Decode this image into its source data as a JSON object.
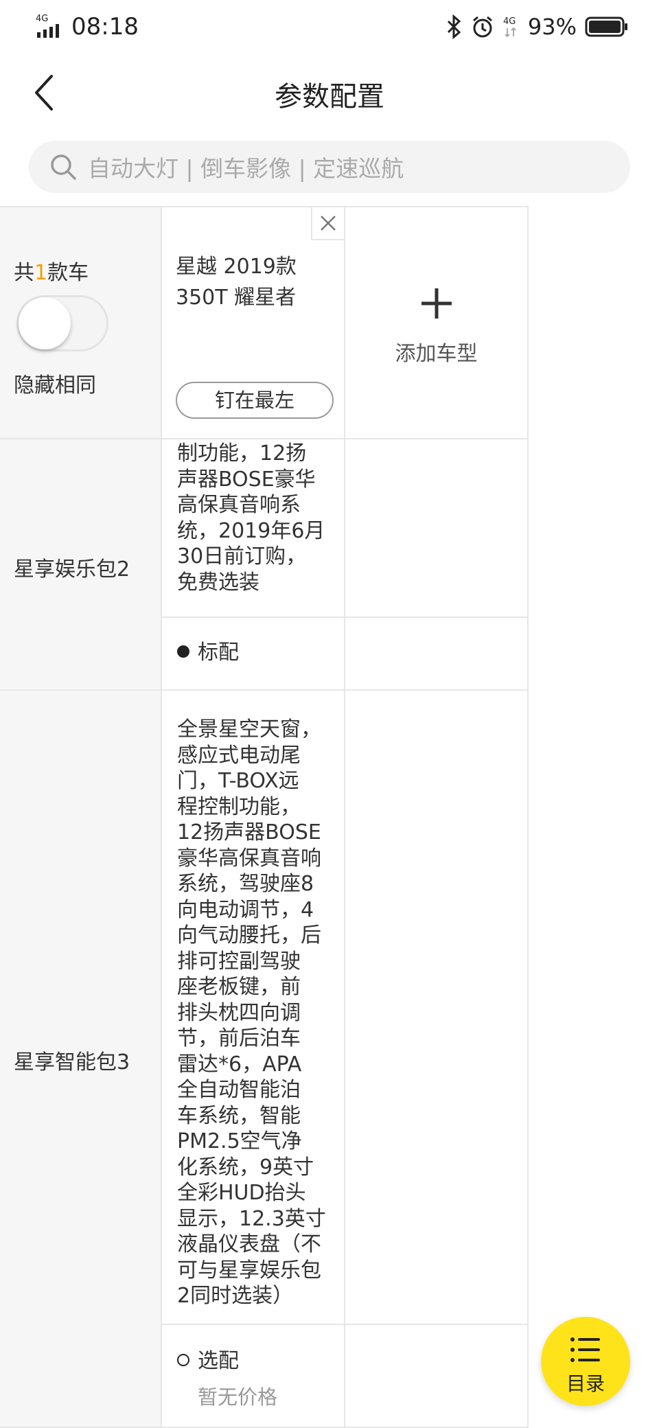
{
  "status_bar": {
    "network": "4G",
    "time": "08:18",
    "network_right": "4G",
    "battery": "93%",
    "icons": [
      "signal-icon",
      "bluetooth-icon",
      "alarm-icon",
      "battery-icon"
    ]
  },
  "nav": {
    "title": "参数配置",
    "back_icon": "chevron-left-icon"
  },
  "search": {
    "placeholder": "自动大灯 | 倒车影像 | 定速巡航",
    "icon": "search-icon"
  },
  "header": {
    "count_prefix": "共",
    "count": "1",
    "count_suffix": "款车",
    "hide_same_label": "隐藏相同",
    "hide_same_on": false,
    "car": {
      "name_line1": "星越 2019款",
      "name_line2": "350T 耀星者",
      "pin_label": "钉在最左"
    },
    "add_label": "添加车型"
  },
  "rows": [
    {
      "label": "星享娱乐包2",
      "description_lines": [
        "制功能，12扬",
        "声器BOSE豪华",
        "高保真音响系",
        "统，2019年6月",
        "30日前订购，",
        "免费选装"
      ],
      "status": "标配"
    },
    {
      "label": "星享智能包3",
      "description_lines": [
        "全景星空天窗，",
        "感应式电动尾",
        "门，T-BOX远",
        "程控制功能，",
        "12扬声器BOSE",
        "豪华高保真音响",
        "系统，驾驶座8",
        "向电动调节，4",
        "向气动腰托，后",
        "排可控副驾驶",
        "座老板键，前",
        "排头枕四向调",
        "节，前后泊车",
        "雷达*6，APA",
        "全自动智能泊",
        "车系统，智能",
        "PM2.5空气净",
        "化系统，9英寸",
        "全彩HUD抬头",
        "显示，12.3英寸",
        "液晶仪表盘（不",
        "可与星享娱乐包",
        "2同时选装）"
      ],
      "status": "选配",
      "price": "暂无价格"
    }
  ],
  "fab": {
    "label": "目录",
    "icon": "list-icon"
  },
  "colors": {
    "accent": "#f4a000",
    "fab": "#ffe31a",
    "label_bg": "#f6f6f6",
    "border": "#e6e6e6"
  }
}
